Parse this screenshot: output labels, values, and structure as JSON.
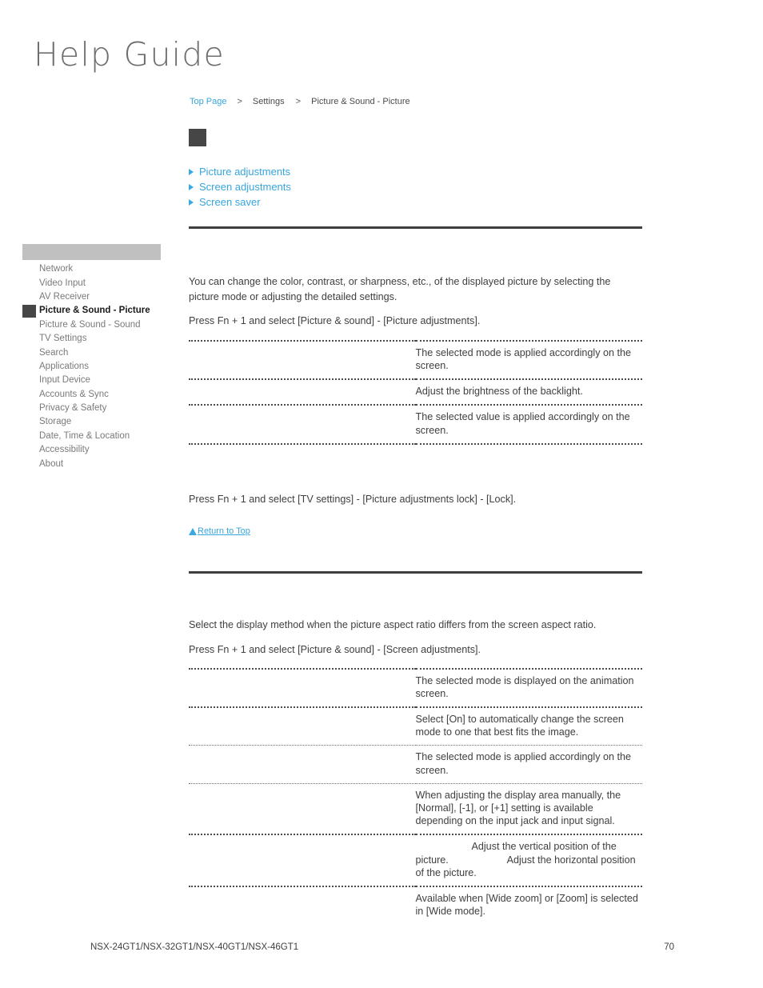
{
  "masthead": {
    "title": "Help Guide"
  },
  "breadcrumb": {
    "top_page": "Top Page",
    "sep1": ">",
    "settings": "Settings",
    "sep2": ">",
    "current": "Picture & Sound - Picture"
  },
  "anchor_links": [
    {
      "label": "Picture adjustments"
    },
    {
      "label": "Screen adjustments"
    },
    {
      "label": "Screen saver"
    }
  ],
  "sidebar": {
    "header_label": "",
    "items": [
      {
        "label": "Network",
        "active": false
      },
      {
        "label": "Video Input",
        "active": false
      },
      {
        "label": "AV Receiver",
        "active": false
      },
      {
        "label": "Picture & Sound - Picture",
        "active": true
      },
      {
        "label": "Picture & Sound - Sound",
        "active": false
      },
      {
        "label": "TV Settings",
        "active": false
      },
      {
        "label": "Search",
        "active": false
      },
      {
        "label": "Applications",
        "active": false
      },
      {
        "label": "Input Device",
        "active": false
      },
      {
        "label": "Accounts & Sync",
        "active": false
      },
      {
        "label": "Privacy & Safety",
        "active": false
      },
      {
        "label": "Storage",
        "active": false
      },
      {
        "label": "Date, Time & Location",
        "active": false
      },
      {
        "label": "Accessibility",
        "active": false
      },
      {
        "label": "About",
        "active": false
      }
    ]
  },
  "section1": {
    "intro": "You can change the color, contrast, or sharpness, etc., of the displayed picture by selecting the picture mode or adjusting the detailed settings.",
    "instruction": "Press Fn + 1 and select [Picture & sound] - [Picture adjustments].",
    "rows": [
      {
        "label": "",
        "desc": "The selected mode is applied accordingly on the screen."
      },
      {
        "label": "",
        "desc": "Adjust the brightness of the backlight."
      },
      {
        "label": "",
        "desc": "The selected value is applied accordingly on the screen."
      }
    ],
    "lock_note": "Press Fn + 1 and select [TV settings] - [Picture adjustments lock] - [Lock].",
    "return_to_top": "Return to Top"
  },
  "section2": {
    "intro": "Select the display method when the picture aspect ratio differs from the screen aspect ratio.",
    "instruction": "Press Fn + 1 and select [Picture & sound] - [Screen adjustments].",
    "rows": [
      {
        "label": "",
        "desc": "The selected mode is displayed on the animation screen."
      },
      {
        "label": "",
        "desc": "Select [On] to automatically change the screen mode to one that best fits the image."
      },
      {
        "label": "",
        "desc": "The selected mode is applied accordingly on the screen."
      },
      {
        "label": "",
        "desc": "When adjusting the display area manually, the [Normal], [-1], or [+1] setting is available depending on the input jack and input signal."
      },
      {
        "label": "",
        "desc": "                    Adjust the vertical position of the picture.                     Adjust the horizontal position of the picture."
      },
      {
        "label": "",
        "desc": "Available when [Wide zoom] or [Zoom] is selected in [Wide mode]."
      }
    ]
  },
  "footer": {
    "model": "NSX-24GT1/NSX-32GT1/NSX-40GT1/NSX-46GT1",
    "page": "70"
  },
  "colors": {
    "link": "#37a5dd",
    "rule": "#3f3f3f",
    "sidebar_header": "#c0c0c0",
    "marker": "#464646",
    "body_text": "#3f3f3f",
    "sidebar_text": "#7a7a7a"
  }
}
